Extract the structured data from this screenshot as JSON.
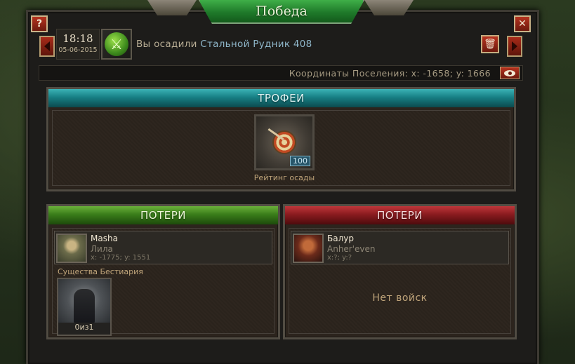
{
  "window": {
    "title": "Победа",
    "help_label": "?",
    "close_label": "✕"
  },
  "event": {
    "time": "18:18",
    "date": "05-06-2015",
    "icon": "siege-sword-icon",
    "prefix": "Вы осадили",
    "target": "Стальной Рудник 408",
    "delete_icon": "trash-icon"
  },
  "coords": {
    "text": "Координаты Поселения: x: -1658; y: 1666",
    "view_icon": "eye-icon"
  },
  "trophies": {
    "header": "ТРОФЕИ",
    "item": {
      "icon": "target-arrow-icon",
      "count": "100",
      "label": "Рейтинг осады"
    }
  },
  "losses_left": {
    "header": "ПОТЕРИ",
    "player": {
      "name": "Masha",
      "alliance": "Лила",
      "coords": "x: -1775; y: 1551"
    },
    "section_label": "Существа Бестиария",
    "unit": {
      "count": "0из1"
    }
  },
  "losses_right": {
    "header": "ПОТЕРИ",
    "player": {
      "name": "Балур",
      "alliance": "Anher'even",
      "coords": "x:?; y:?"
    },
    "empty_text": "Нет войск"
  },
  "colors": {
    "trophy_header": "#177f84",
    "loss_left_header": "#3a7d1a",
    "loss_right_header": "#8a1b1f",
    "accent_button": "#b5331f"
  }
}
